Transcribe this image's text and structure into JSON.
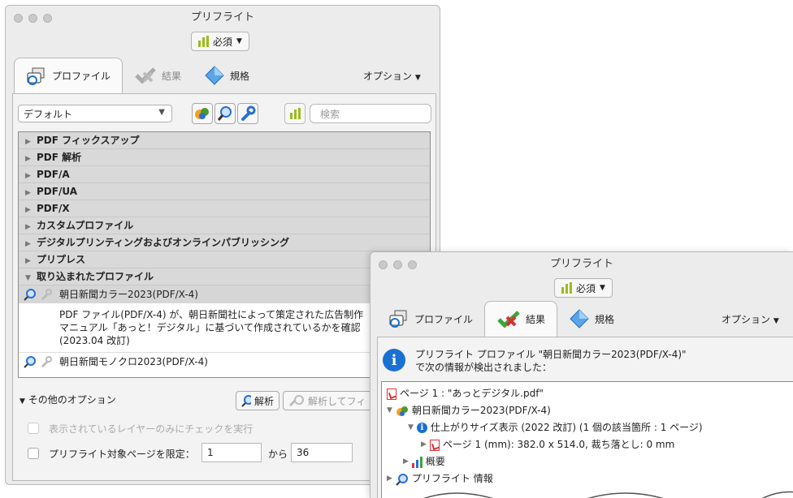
{
  "window1": {
    "title": "プリフライト",
    "mode_button": "必須",
    "tabs": [
      {
        "label": "プロファイル",
        "icon": "profile-icon"
      },
      {
        "label": "結果",
        "icon": "checkmark-x-icon"
      },
      {
        "label": "規格",
        "icon": "diamond-icon"
      }
    ],
    "options_label": "オプション",
    "library_select": "デフォルト",
    "search_placeholder": "検索",
    "groups": [
      "PDF フィックスアップ",
      "PDF 解析",
      "PDF/A",
      "PDF/UA",
      "PDF/X",
      "カスタムプロファイル",
      "デジタルプリンティングおよびオンラインパブリッシング",
      "プリプレス"
    ],
    "imported_group": "取り込まれたプロファイル",
    "profile1": "朝日新聞カラー2023(PDF/X-4)",
    "edit_button": "編集",
    "profile1_desc": [
      "PDF ファイル(PDF/X-4) が、朝日新聞社によって策定された広告制作",
      "マニュアル「あっと！デジタル」に基づいて作成されているかを確認",
      "(2023.04 改訂)"
    ],
    "profile2": "朝日新聞モノクロ2023(PDF/X-4)",
    "other_options": "その他のオプション",
    "analyze_button": "解析",
    "analyze_fix_button": "解析してフィ",
    "layers_checkbox": "表示されているレイヤーのみにチェックを実行",
    "pages_checkbox": "プリフライト対象ページを限定：",
    "page_from": "1",
    "page_to_label": "から",
    "page_to": "36"
  },
  "window2": {
    "title": "プリフライト",
    "mode_button": "必須",
    "tabs": [
      {
        "label": "プロファイル",
        "icon": "profile-icon"
      },
      {
        "label": "結果",
        "icon": "checkmark-x-icon"
      },
      {
        "label": "規格",
        "icon": "diamond-icon"
      }
    ],
    "options_label": "オプション",
    "summary_line1": "プリフライト プロファイル \"朝日新聞カラー2023(PDF/X-4)\"",
    "summary_line2": "で次の情報が検出されました：",
    "tree": {
      "page": "ページ 1 : \"あっとデジタル.pdf\"",
      "profile": "朝日新聞カラー2023(PDF/X-4)",
      "finding": "仕上がりサイズ表示 (2022 改訂) (1 個の該当箇所 : 1 ページ)",
      "detail": "ページ 1 (mm): 382.0 x 514.0, 裁ち落とし: 0 mm",
      "overview": "概要",
      "info": "プリフライト 情報"
    }
  },
  "colors": {
    "accent_green": "#9dbb1e",
    "info_blue": "#1a6fd3",
    "error_red": "#d33333"
  }
}
